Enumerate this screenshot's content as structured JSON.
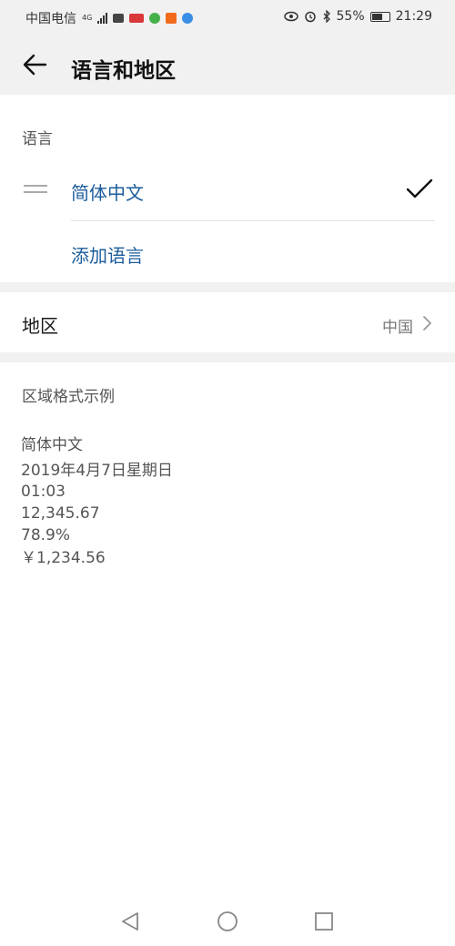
{
  "status_bar": {
    "carrier": "中国电信",
    "network": "4G",
    "battery": "55%",
    "battery_level": 0.55,
    "time": "21:29"
  },
  "header": {
    "title": "语言和地区"
  },
  "language_section": {
    "label": "语言",
    "languages": [
      {
        "name": "简体中文",
        "selected": true
      }
    ],
    "add_language": "添加语言"
  },
  "region_row": {
    "label": "地区",
    "value": "中国"
  },
  "format_section": {
    "label": "区域格式示例",
    "samples": [
      "简体中文",
      "2019年4月7日星期日",
      "01:03",
      "12,345.67",
      "78.9%",
      "￥1,234.56"
    ]
  },
  "colors": {
    "accent": "#1c5d9c",
    "band": "#f1f1f1"
  },
  "icons": [
    "back-arrow-icon",
    "drag-handle-icon",
    "checkmark-icon",
    "chevron-right-icon",
    "nav-back-icon",
    "nav-home-icon",
    "nav-recents-icon"
  ]
}
